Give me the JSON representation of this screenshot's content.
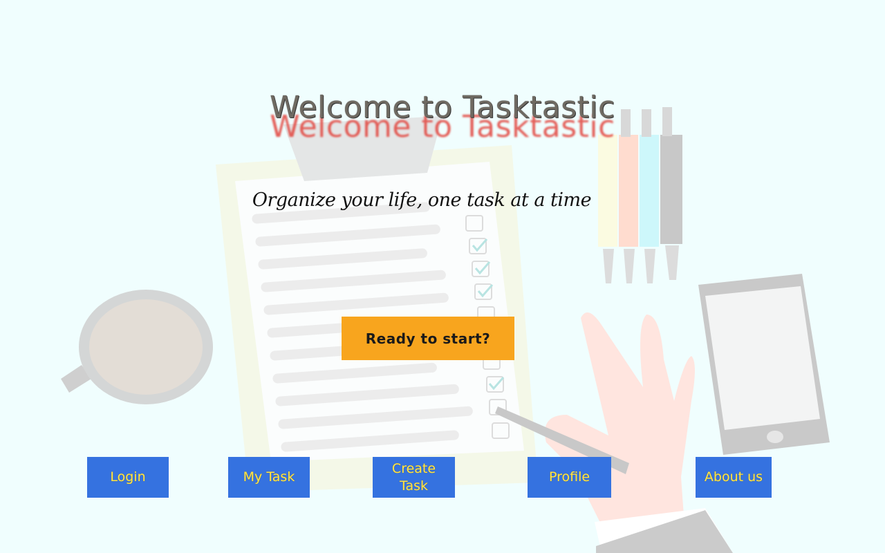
{
  "page": {
    "title": "Welcome to Tasktastic",
    "tagline": "Organize your life, one task at a time"
  },
  "cta": {
    "label": "Ready to start?"
  },
  "nav": {
    "login": "Login",
    "my_task": "My Task",
    "create_task": "Create Task",
    "profile": "Profile",
    "about": "About us"
  },
  "colors": {
    "background": "#f0fefe",
    "cta": "#f8a51e",
    "nav_button": "#3572e0",
    "nav_text": "#ffe54a",
    "title_shadow": "#e2443d"
  }
}
